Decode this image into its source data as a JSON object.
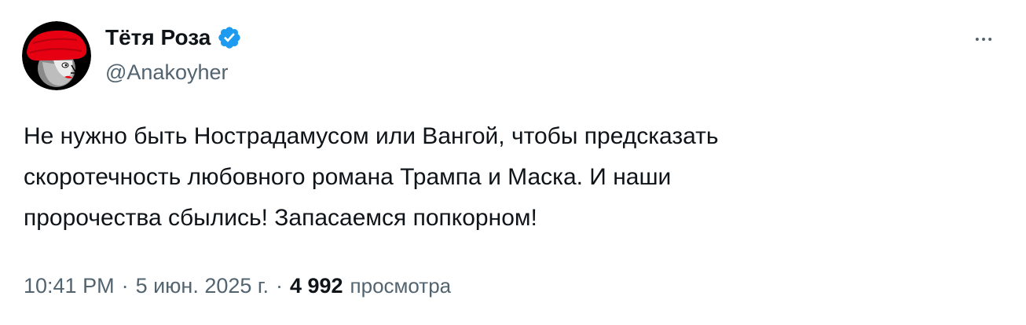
{
  "author": {
    "display_name": "Тётя Роза",
    "handle": "@Anakoyher",
    "verified": true,
    "verified_color": "#1d9bf0"
  },
  "post": {
    "text": "Не нужно быть Нострадамусом или Вангой, чтобы предсказать\nскоротечность любовного романа Трампа и Маска. И наши\nпророчества сбылись! Запасаемся попкорном!"
  },
  "meta": {
    "time": "10:41 PM",
    "separator": "·",
    "date": "5 июн. 2025 г.",
    "views_count": "4 992",
    "views_label": "просмотра"
  },
  "icons": {
    "more": "more-horizontal-icon",
    "verified": "verified-badge-icon"
  },
  "colors": {
    "text_primary": "#0f1419",
    "text_secondary": "#536471",
    "avatar_background": "#000000",
    "avatar_hat": "#e60012"
  }
}
